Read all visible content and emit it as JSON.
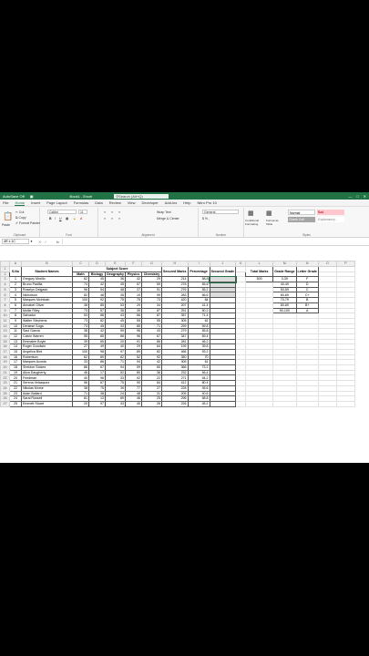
{
  "titlebar": {
    "autosave": "AutoSave",
    "autosave_state": "Off",
    "title": "Book1 - Excel",
    "search": "Search (Alt+Q)"
  },
  "menu": [
    "File",
    "Home",
    "Insert",
    "Page Layout",
    "Formulas",
    "Data",
    "Review",
    "View",
    "Developer",
    "Add-ins",
    "Help",
    "Nitro Pro 10"
  ],
  "ribbon": {
    "clipboard": {
      "label": "Clipboard",
      "cut": "Cut",
      "copy": "Copy",
      "painter": "Format Painter",
      "paste": "Paste"
    },
    "font": {
      "label": "Font",
      "name": "Calibri",
      "size": "11"
    },
    "alignment": {
      "label": "Alignment",
      "wrap": "Wrap Text",
      "merge": "Merge & Center"
    },
    "number": {
      "label": "Number",
      "format": "General"
    },
    "styles": {
      "label": "Styles",
      "cond": "Conditional Formatting",
      "table": "Format as Table",
      "normal": "Normal",
      "bad": "Bad",
      "check": "Check Cell",
      "expl": "Explanatory..."
    }
  },
  "formula": {
    "namebox": "4R x 1C",
    "fx": "fx"
  },
  "columns": [
    "A",
    "B",
    "C",
    "D",
    "E",
    "F",
    "G",
    "H",
    "I",
    "J",
    "K",
    "L",
    "M",
    "N",
    "O",
    "P"
  ],
  "headers": {
    "sno": "S.No",
    "name": "Student Names",
    "subject": "Subject Score",
    "subjects": [
      "Math",
      "Biology",
      "Geography",
      "Physics",
      "Chemistry"
    ],
    "secured": "Secured Marks",
    "percentage": "Percentage",
    "grade": "Secured Grade",
    "total": "Total Marks",
    "range": "Grade Range",
    "letter": "Letter Grade"
  },
  "total_marks": "500",
  "grades": [
    {
      "range": "0-39",
      "letter": "F"
    },
    {
      "range": "40-49",
      "letter": "D"
    },
    {
      "range": "50-59",
      "letter": "C"
    },
    {
      "range": "60-69",
      "letter": "C+"
    },
    {
      "range": "70-79",
      "letter": "B"
    },
    {
      "range": "80-89",
      "letter": "B+"
    },
    {
      "range": "90-100",
      "letter": "A"
    }
  ],
  "students": [
    [
      "1",
      "Gregory Murillo",
      "62",
      "45",
      "36",
      "42",
      "29",
      "214",
      "58.8"
    ],
    [
      "2",
      "Bruno Padilla",
      "74",
      "42",
      "45",
      "57",
      "59",
      "278",
      "55.6"
    ],
    [
      "3",
      "Roselyn Delgado",
      "96",
      "54",
      "48",
      "27",
      "51",
      "276",
      "55.2"
    ],
    [
      "4",
      "Nicholson",
      "82",
      "48",
      "35",
      "19",
      "99",
      "283",
      "56.6"
    ],
    [
      "5",
      "Marques Mcintosh",
      "100",
      "92",
      "75",
      "75",
      "73",
      "420",
      "84"
    ],
    [
      "6",
      "Annabel Oliver",
      "38",
      "85",
      "53",
      "29",
      "34",
      "207",
      "41.4"
    ],
    [
      "7",
      "Mollie Riley",
      "73",
      "57",
      "35",
      "39",
      "87",
      "251",
      "50.2"
    ],
    [
      "8",
      "Salvador",
      "53",
      "88",
      "43",
      "66",
      "87",
      "357",
      "71.4"
    ],
    [
      "9",
      "Walter Stephens",
      "73",
      "82",
      "45",
      "55",
      "55",
      "305",
      "61"
    ],
    [
      "10",
      "Deniese Soga",
      "73",
      "45",
      "33",
      "85",
      "71",
      "299",
      "59.8"
    ],
    [
      "11",
      "Saul Garcia",
      "38",
      "42",
      "59",
      "96",
      "43",
      "279",
      "55.8"
    ],
    [
      "12",
      "Calvin Warren",
      "55",
      "85",
      "88",
      "96",
      "67",
      "347",
      "69.4"
    ],
    [
      "13",
      "Emmalee Boyle",
      "39",
      "55",
      "20",
      "91",
      "86",
      "281",
      "46.2"
    ],
    [
      "14",
      "Roger Goodwin",
      "27",
      "49",
      "40",
      "29",
      "64",
      "199",
      "39.8"
    ],
    [
      "15",
      "Angelica Bird",
      "100",
      "98",
      "97",
      "89",
      "82",
      "466",
      "93.2"
    ],
    [
      "16",
      "Robertson",
      "62",
      "89",
      "82",
      "52",
      "92",
      "350",
      "70"
    ],
    [
      "17",
      "Marques Acosta",
      "33",
      "86",
      "71",
      "94",
      "42",
      "305",
      "61"
    ],
    [
      "18",
      "Sheldon Stokes",
      "86",
      "67",
      "94",
      "59",
      "60",
      "366",
      "73.2"
    ],
    [
      "19",
      "Aliza Daugherty",
      "46",
      "17",
      "52",
      "80",
      "36",
      "232",
      "46.4"
    ],
    [
      "20",
      "Friedman",
      "40",
      "96",
      "33",
      "92",
      "22",
      "271",
      "54.2"
    ],
    [
      "21",
      "Serena Velazquez",
      "96",
      "67",
      "75",
      "90",
      "84",
      "412",
      "80.4"
    ],
    [
      "22",
      "Nikolas Morse",
      "38",
      "75",
      "39",
      "77",
      "27",
      "228",
      "45.6"
    ],
    [
      "23",
      "Adan Ballard",
      "71",
      "38",
      "24",
      "48",
      "31",
      "205",
      "40.6"
    ],
    [
      "24",
      "Sarai Russell",
      "81",
      "13",
      "89",
      "46",
      "25",
      "296",
      "58.8"
    ],
    [
      "25",
      "Emmett Stuart",
      "20",
      "97",
      "43",
      "40",
      "26",
      "226",
      "45.2"
    ]
  ]
}
